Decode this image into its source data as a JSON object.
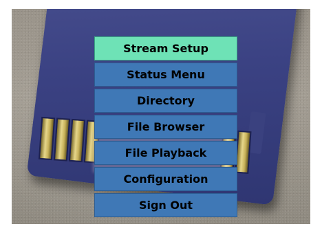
{
  "menu": {
    "items": [
      {
        "label": "Stream Setup",
        "selected": true
      },
      {
        "label": "Status Menu",
        "selected": false
      },
      {
        "label": "Directory",
        "selected": false
      },
      {
        "label": "File Browser",
        "selected": false
      },
      {
        "label": "File Playback",
        "selected": false
      },
      {
        "label": "Configuration",
        "selected": false
      },
      {
        "label": "Sign Out",
        "selected": false
      }
    ]
  },
  "colors": {
    "menu_item": "#3f78b6",
    "menu_item_selected": "#6ee2b6",
    "card": "#3b4283"
  }
}
